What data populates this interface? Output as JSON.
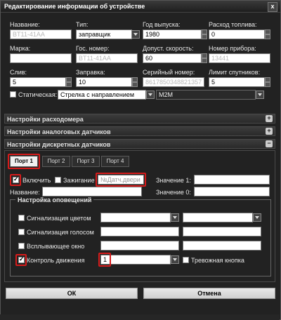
{
  "window": {
    "title": "Редактирование информации об устройстве",
    "close_glyph": "x"
  },
  "device": {
    "name_label": "Название:",
    "name_value": "BT11-41АА",
    "type_label": "Тип:",
    "type_value": "заправщик",
    "year_label": "Год выпуска:",
    "year_value": "1980",
    "fuel_label": "Расход топлива:",
    "fuel_value": "0",
    "brand_label": "Марка:",
    "brand_value": "",
    "plate_label": "Гос. номер:",
    "plate_value": "BT11-41АА",
    "speed_label": "Допуст. скорость:",
    "speed_value": "60",
    "devnum_label": "Номер прибора:",
    "devnum_value": "13441",
    "drain_label": "Слив:",
    "drain_value": "5",
    "refuel_label": "Заправка:",
    "refuel_value": "10",
    "serial_label": "Серийный номер:",
    "serial_value": "8617850348821357",
    "satlimit_label": "Лимит спутников:",
    "satlimit_value": "5",
    "static_label": "Статическая:",
    "icon_value": "Стрелка с направлением",
    "protocol_value": "M2M"
  },
  "sections": {
    "flowmeter": "Настройки расходомера",
    "analog": "Настройки аналоговых датчиков",
    "discrete": "Настройки дискретных датчиков",
    "plus": "+",
    "minus": "−"
  },
  "tabs": [
    {
      "label": "Порт 1",
      "active": true
    },
    {
      "label": "Порт 2",
      "active": false
    },
    {
      "label": "Порт 3",
      "active": false
    },
    {
      "label": "Порт 4",
      "active": false
    }
  ],
  "port": {
    "enable_label": "Включить",
    "enable_checked": true,
    "ignition_label": "Зажигание",
    "ignition_checked": false,
    "sensor_placeholder": "№Датч.двери",
    "value1_label": "Значение 1:",
    "value1": "",
    "name_label": "Название:",
    "name_value": "",
    "value0_label": "Значение 0:",
    "value0": ""
  },
  "alerts": {
    "legend": "Настройка оповещений",
    "color_label": "Сигнализация цветом",
    "voice_label": "Сигнализация голосом",
    "popup_label": "Всплывающее окно",
    "motion_label": "Контроль движения",
    "motion_checked": true,
    "motion_value": "1",
    "panic_label": "Тревожная кнопка"
  },
  "buttons": {
    "ok": "ОК",
    "cancel": "Отмена"
  }
}
